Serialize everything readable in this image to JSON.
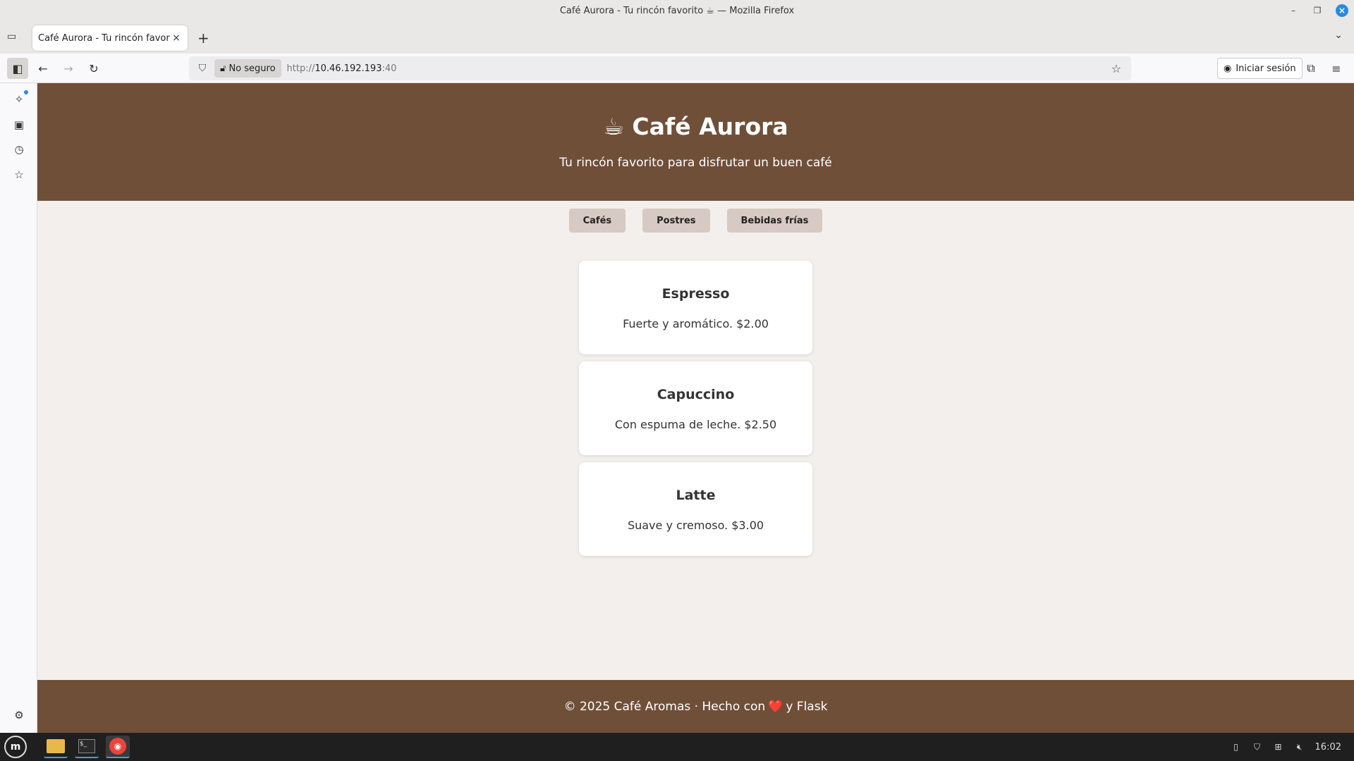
{
  "window": {
    "title": "Café Aurora - Tu rincón favorito ☕ — Mozilla Firefox"
  },
  "tabs": [
    {
      "label": "Café Aurora - Tu rincón favorito"
    }
  ],
  "navbar": {
    "security_label": "No seguro",
    "url_prefix": "http://",
    "url_host": "10.46.192.193",
    "url_port": ":40",
    "signin_label": "Iniciar sesión"
  },
  "site": {
    "title": "☕ Café Aurora",
    "subtitle": "Tu rincón favorito para disfrutar un buen café",
    "categories": [
      "Cafés",
      "Postres",
      "Bebidas frías"
    ],
    "items": [
      {
        "name": "Espresso",
        "desc": "Fuerte y aromático. $2.00"
      },
      {
        "name": "Capuccino",
        "desc": "Con espuma de leche. $2.50"
      },
      {
        "name": "Latte",
        "desc": "Suave y cremoso. $3.00"
      }
    ],
    "footer_before": "© 2025 Café Aromas · Hecho con",
    "footer_heart": "❤️",
    "footer_after": "y Flask"
  },
  "taskbar": {
    "clock": "16:02"
  },
  "colors": {
    "brand_brown": "#704f39",
    "page_bg": "#f3efec",
    "category_button": "#d7c9c3"
  },
  "icons": {
    "sidebar": [
      "ai-sparkle-icon",
      "synced-tabs-icon",
      "history-icon",
      "bookmarks-icon",
      "settings-icon"
    ],
    "taskbar": [
      "mint-menu-icon",
      "files-icon",
      "terminal-icon",
      "firefox-icon"
    ],
    "tray": [
      "clipboard-icon",
      "shield-icon",
      "network-icon",
      "volume-muted-icon"
    ]
  }
}
